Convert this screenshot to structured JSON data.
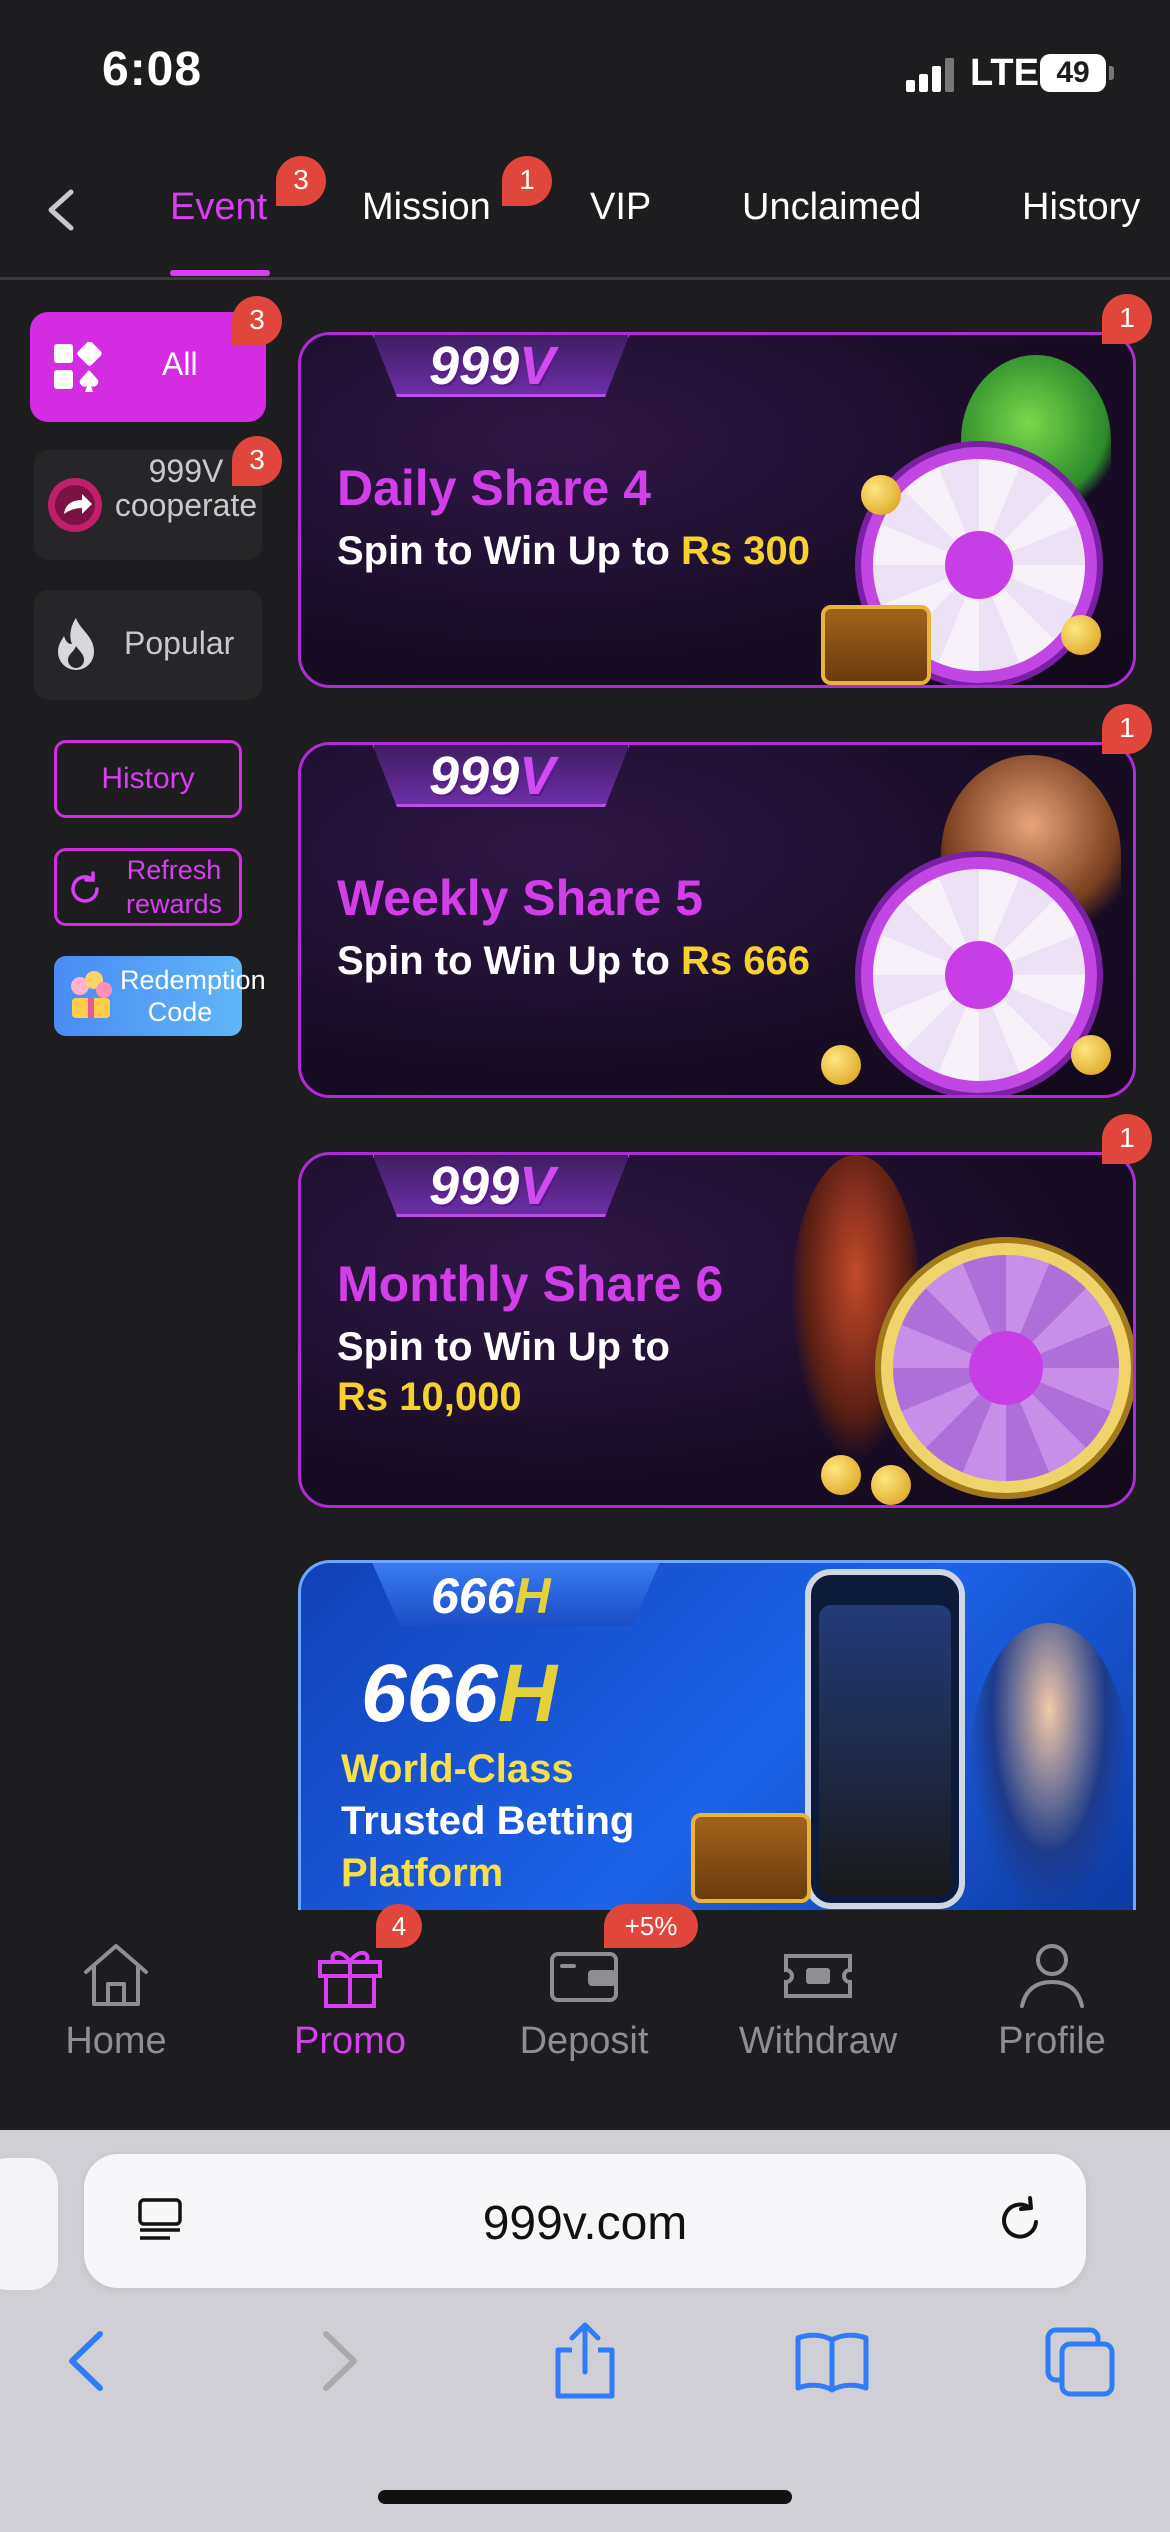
{
  "status_bar": {
    "time": "6:08",
    "network": "LTE",
    "battery": "49"
  },
  "top_tabs": [
    {
      "label": "Event",
      "badge": "3",
      "active": true
    },
    {
      "label": "Mission",
      "badge": "1"
    },
    {
      "label": "VIP"
    },
    {
      "label": "Unclaimed"
    },
    {
      "label": "History"
    }
  ],
  "sidebar": {
    "all": {
      "label": "All",
      "badge": "3"
    },
    "cooperate": {
      "label": "999V cooperate",
      "badge": "3"
    },
    "popular": {
      "label": "Popular"
    },
    "history_button": "History",
    "refresh_button": "Refresh rewards",
    "redeem_button": "Redemption Code"
  },
  "banners": [
    {
      "brand": "999",
      "brand_v": "V",
      "title": "Daily Share 4",
      "subtitle": "Spin to Win Up to",
      "amount": "Rs 300",
      "badge": "1"
    },
    {
      "brand": "999",
      "brand_v": "V",
      "title": "Weekly Share 5",
      "subtitle": "Spin to Win Up to",
      "amount": "Rs 666",
      "badge": "1"
    },
    {
      "brand": "999",
      "brand_v": "V",
      "title": "Monthly Share 6",
      "subtitle": "Spin to Win Up to",
      "amount": "Rs 10,000",
      "badge": "1"
    }
  ],
  "promo_banner": {
    "brand": "666",
    "brand_h": "H",
    "line1": "World-Class",
    "line2": "Trusted Betting",
    "line3": "Platform"
  },
  "bottom_nav": [
    {
      "label": "Home",
      "icon": "home-icon"
    },
    {
      "label": "Promo",
      "icon": "gift-icon",
      "badge": "4",
      "active": true
    },
    {
      "label": "Deposit",
      "icon": "wallet-icon",
      "badge": "+5%"
    },
    {
      "label": "Withdraw",
      "icon": "ticket-icon"
    },
    {
      "label": "Profile",
      "icon": "person-icon"
    }
  ],
  "browser": {
    "url": "999v.com"
  },
  "colors": {
    "accent": "#d83ef2",
    "badge": "#e0463b",
    "background": "#1d1d1f"
  }
}
